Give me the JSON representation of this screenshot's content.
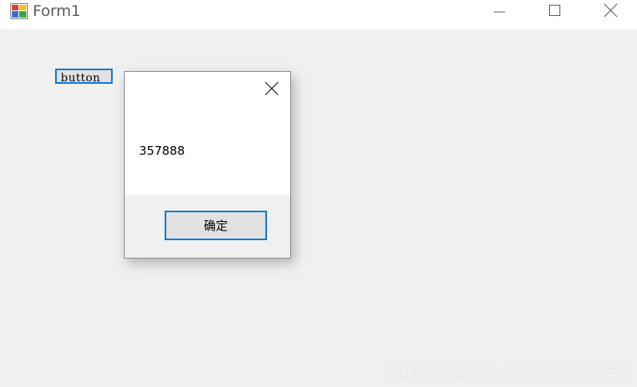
{
  "window": {
    "title": "Form1",
    "app_icon": "form-app-icon",
    "controls": {
      "minimize_icon": "minimize-icon",
      "maximize_icon": "maximize-icon",
      "close_icon": "close-icon"
    }
  },
  "form": {
    "button_label": "button"
  },
  "message_box": {
    "message": "357888",
    "close_icon": "close-icon",
    "ok_label": "确定"
  },
  "watermark": "https://blog.csdn.net/coldwind811201",
  "colors": {
    "accent": "#0078d7",
    "background": "#f0f0f0",
    "button_face": "#e1e1e1"
  }
}
